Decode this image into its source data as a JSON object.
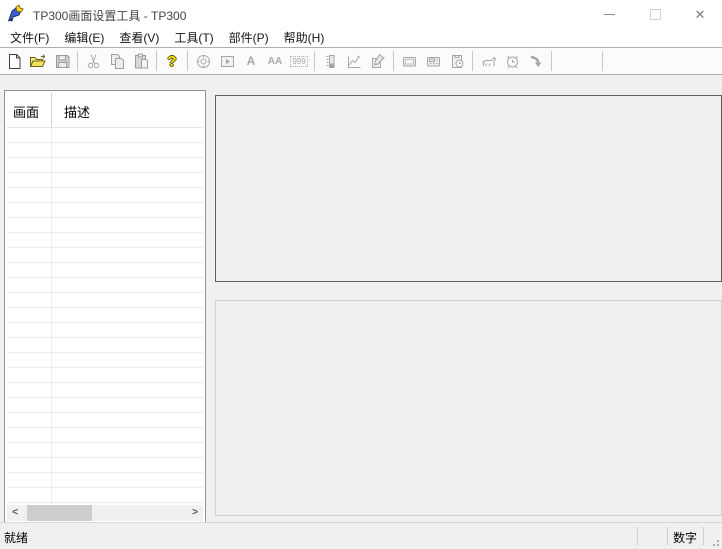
{
  "window": {
    "title": "TP300画面设置工具 - TP300",
    "close_glyph": "✕"
  },
  "menu": {
    "items": [
      "文件(F)",
      "编辑(E)",
      "查看(V)",
      "工具(T)",
      "部件(P)",
      "帮助(H)"
    ]
  },
  "toolbar": {
    "help_glyph": "?",
    "static_text_label": "A",
    "text_display_label": "AA",
    "numeric_display_label": "999"
  },
  "screen_list": {
    "columns": [
      "画面",
      "描述"
    ]
  },
  "scrollbar": {
    "left_glyph": "<",
    "right_glyph": ">"
  },
  "status": {
    "ready": "就绪",
    "num": "数字"
  },
  "colors": {
    "folder_yellow": "#f1e35f",
    "help_yellow": "#f6e400",
    "disabled_gray": "#a6a6a6",
    "panel_gray": "#efefef"
  }
}
